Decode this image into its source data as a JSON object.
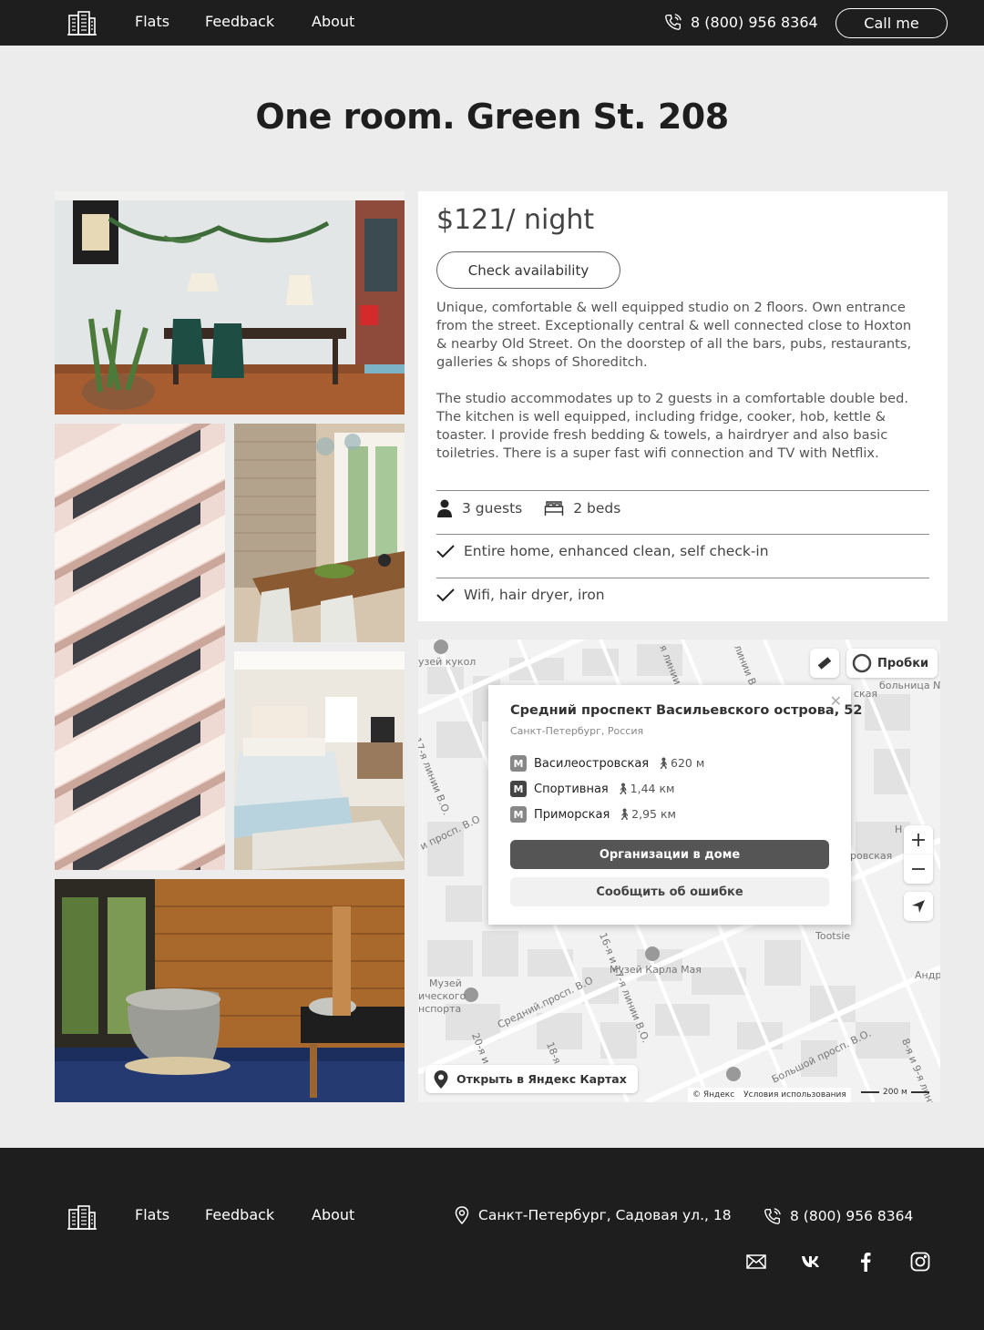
{
  "header": {
    "nav": [
      "Flats",
      "Feedback",
      "About"
    ],
    "phone": "8 (800) 956 8364",
    "call_label": "Call me"
  },
  "title": "One room. Green St. 208",
  "listing": {
    "price": "$121/ night",
    "check_label": "Check availability",
    "description_1": "Unique, comfortable & well equipped studio on 2 floors. Own entrance from the street. Exceptionally central & well connected close to Hoxton & nearby Old Street. On the doorstep of all the bars, pubs, restaurants, galleries & shops of Shoreditch.",
    "description_2": "The studio accommodates up to 2 guests in a comfortable double bed. The kitchen is well equipped, including fridge, cooker, hob, kettle & toaster. I provide fresh bedding & towels, a hairdryer and also basic toiletries. There is a super fast wifi connection and TV with Netflix.",
    "guests": "3 guests",
    "beds": "2 beds",
    "feature_1": "Entire home, enhanced clean, self check-in",
    "feature_2": "Wifi, hair dryer, iron"
  },
  "map": {
    "address": "Средний проспект Васильевского острова, 52",
    "city": "Санкт-Петербург, Россия",
    "metro": [
      {
        "name": "Василеостровская",
        "dist": "620 м"
      },
      {
        "name": "Спортивная",
        "dist": "1,44 км"
      },
      {
        "name": "Приморская",
        "dist": "2,95 км"
      }
    ],
    "orgs_label": "Организации в доме",
    "error_label": "Сообщить об ошибке",
    "traffic_label": "Пробки",
    "open_label": "Открыть в Яндекс Картах",
    "copyright": "© Яндекс",
    "terms": "Условия использования",
    "scale": "200 м",
    "labels": {
      "dolls": "узей кукол",
      "line17": "и 17-я линии В.О.",
      "line8": "линии В.О.",
      "sredniy": "Средний.просп. В.О",
      "museum": "Музей Карла Мая",
      "museum2": "Музей",
      "museum2b": "ического",
      "museum2c": "нспорта",
      "line16": "16-я и 17-я линии В.О.",
      "bolshoy": "Большой просп. В.О.",
      "line89": "8-я и 9-я линии В.О.",
      "tootsie": "Tootsie",
      "hospital": "больница №",
      "vskaya": "ровская",
      "prosp": "и просп. В.О",
      "line20": "20-я и 21",
      "line18": "18-я и",
      "andr": "Андр",
      "line89b": "8-я и 9-я",
      "lineB": "я линии В.О.",
      "lineC": "линии В.О.",
      "ska": "ская",
      "n": "Н"
    }
  },
  "footer": {
    "nav": [
      "Flats",
      "Feedback",
      "About"
    ],
    "address": "Санкт-Петербург, Садовая ул., 18",
    "phone": "8 (800) 956 8364"
  },
  "colors": {
    "dark": "#1e1e1e",
    "background": "#ececec",
    "card": "#ffffff"
  }
}
